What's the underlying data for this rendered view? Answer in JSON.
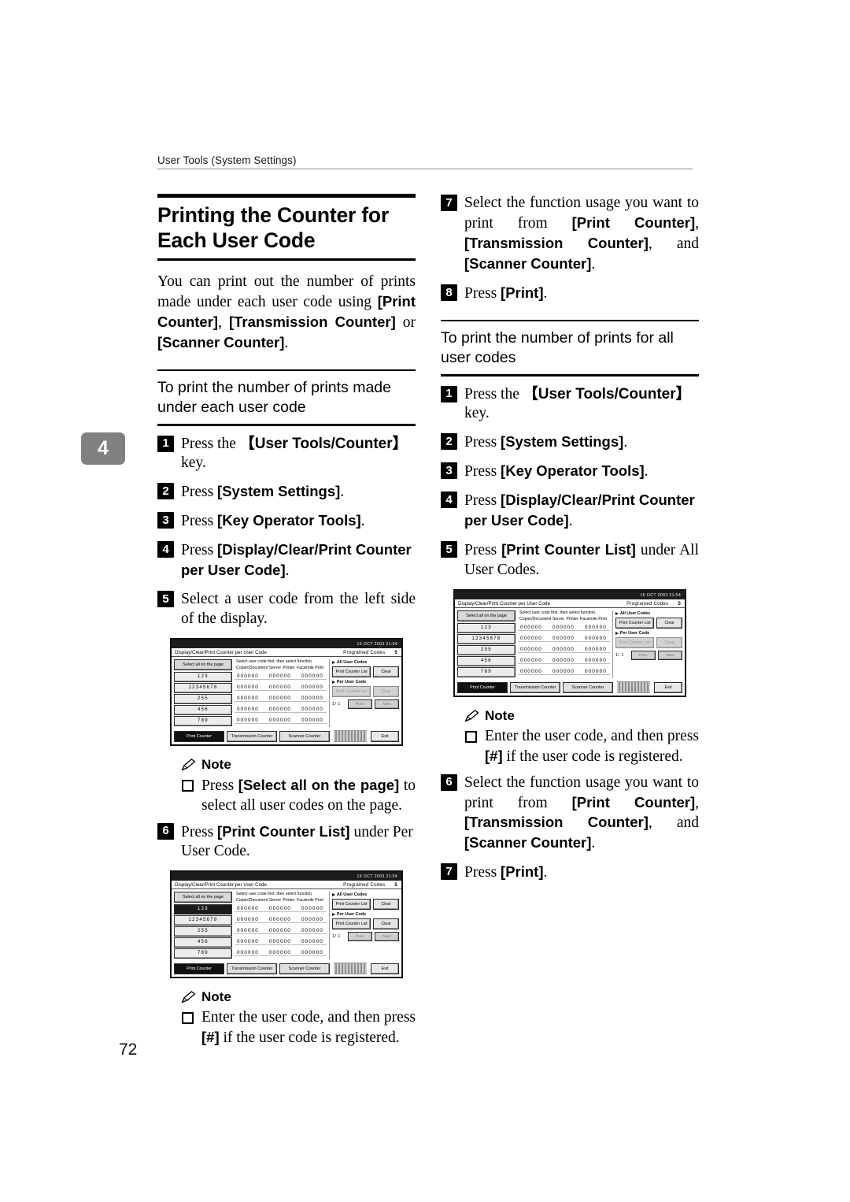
{
  "running_header": "User Tools (System Settings)",
  "chapter_tab": "4",
  "page_number": "72",
  "left_column": {
    "title": "Printing the Counter for Each User Code",
    "intro_part1": "You can print out the number of prints made under each user code using ",
    "intro_b1": "[Print Counter]",
    "intro_sep1": ", ",
    "intro_b2": "[Transmission Counter]",
    "intro_sep2": " or ",
    "intro_b3": "[Scanner Counter]",
    "intro_end": ".",
    "subheading": "To print the number of prints made under each user code",
    "steps": [
      {
        "num": "1",
        "pre": "Press the ",
        "bold": "【User Tools/Counter】",
        "post": " key."
      },
      {
        "num": "2",
        "pre": "Press ",
        "bold": "[System Settings]",
        "post": "."
      },
      {
        "num": "3",
        "pre": "Press ",
        "bold": "[Key Operator Tools]",
        "post": "."
      },
      {
        "num": "4",
        "pre": "Press ",
        "bold": "[Display/Clear/Print Counter per User Code]",
        "post": "."
      },
      {
        "num": "5",
        "pre": "Select a user code from the left side of the display.",
        "bold": "",
        "post": ""
      }
    ],
    "note1": {
      "label": "Note",
      "pre": "Press ",
      "bold": "[Select all on the page]",
      "post": " to select all user codes on the page."
    },
    "step6": {
      "num": "6",
      "pre": "Press ",
      "bold": "[Print Counter List]",
      "post": " under Per User Code."
    },
    "note2": {
      "label": "Note",
      "pre": "Enter the user code, and then press ",
      "bold": "[#]",
      "post": " if the user code is registered."
    }
  },
  "right_column": {
    "step7": {
      "num": "7",
      "pre": "Select the function usage you want to print from ",
      "b1": "[Print Counter]",
      "s1": ", ",
      "b2": "[Transmission Counter]",
      "s2": ", and ",
      "b3": "[Scanner Counter]",
      "end": "."
    },
    "step8": {
      "num": "8",
      "pre": "Press ",
      "bold": "[Print]",
      "post": "."
    },
    "subheading": "To print the number of prints for all user codes",
    "steps": [
      {
        "num": "1",
        "pre": "Press the ",
        "bold": "【User Tools/Counter】",
        "post": " key."
      },
      {
        "num": "2",
        "pre": "Press ",
        "bold": "[System Settings]",
        "post": "."
      },
      {
        "num": "3",
        "pre": "Press ",
        "bold": "[Key Operator Tools]",
        "post": "."
      },
      {
        "num": "4",
        "pre": "Press ",
        "bold": "[Display/Clear/Print Counter per User Code]",
        "post": "."
      },
      {
        "num": "5",
        "pre": "Press ",
        "bold": "[Print Counter List]",
        "post": " under All User Codes."
      }
    ],
    "note1": {
      "label": "Note",
      "pre": "Enter the user code, and then press ",
      "bold": "[#]",
      "post": " if the user code is registered."
    },
    "step6": {
      "num": "6",
      "pre": "Select the function usage you want to print from ",
      "b1": "[Print Counter]",
      "s1": ", ",
      "b2": "[Transmission Counter]",
      "s2": ", and ",
      "b3": "[Scanner Counter]",
      "end": "."
    },
    "step7b": {
      "num": "7",
      "pre": "Press ",
      "bold": "[Print]",
      "post": "."
    }
  },
  "lcd": {
    "statusbar": "15 OCT  2003 21:54",
    "title": "Display/Clear/Print Counter per User Code",
    "programmed_codes_label": "Programed Codes",
    "programmed_codes_value": "5",
    "select_all_button": "Select all on the page",
    "hint": "Select user code first, then select function.",
    "col_copier": "Copier/Document Server",
    "col_printer": "Printer",
    "col_fax": "Facsimile Print",
    "user_codes": [
      "123",
      "12345678",
      "255",
      "456",
      "789"
    ],
    "counts": [
      "000000",
      "000000",
      "000000"
    ],
    "all_user_codes_label": "All User Codes",
    "per_user_code_label": "Per User Code",
    "print_counter_list": "Print Counter List",
    "clear": "Clear",
    "page_indicator": "1/ 1",
    "prev": "Prev.",
    "next": "Next",
    "tab_print": "Print Counter",
    "tab_transmission": "Transmission Counter",
    "tab_scanner": "Scanner Counter",
    "exit": "Exit"
  }
}
